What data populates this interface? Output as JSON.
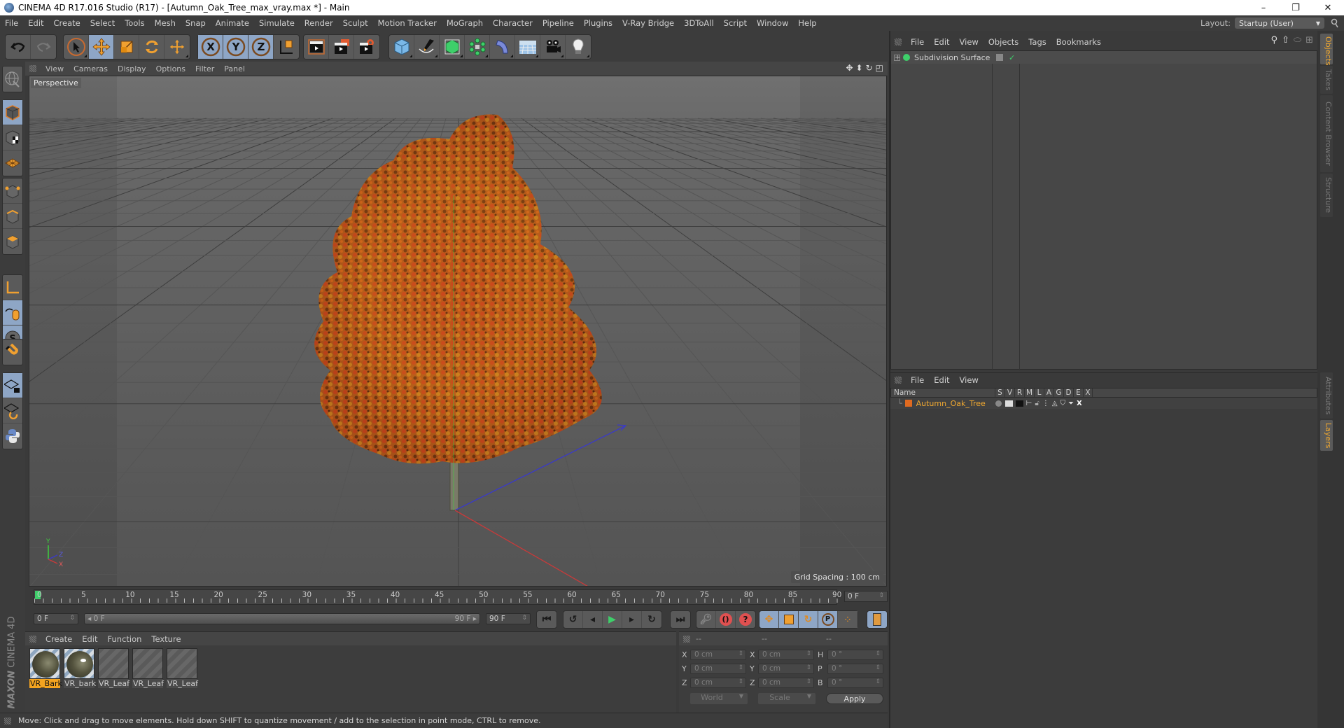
{
  "window": {
    "title": "CINEMA 4D R17.016 Studio (R17) - [Autumn_Oak_Tree_max_vray.max *] - Main",
    "controls": [
      "minimize",
      "restore",
      "close"
    ]
  },
  "menubar": {
    "items": [
      "File",
      "Edit",
      "Create",
      "Select",
      "Tools",
      "Mesh",
      "Snap",
      "Animate",
      "Simulate",
      "Render",
      "Sculpt",
      "Motion Tracker",
      "MoGraph",
      "Character",
      "Pipeline",
      "Plugins",
      "V-Ray Bridge",
      "3DToAll",
      "Script",
      "Window",
      "Help"
    ],
    "layout_label": "Layout:",
    "layout_value": "Startup (User)"
  },
  "toolbar": {
    "groups": [
      {
        "name": "history",
        "buttons": [
          {
            "icon": "undo-icon",
            "active": false
          },
          {
            "icon": "redo-icon",
            "active": false
          }
        ]
      },
      {
        "name": "tools",
        "buttons": [
          {
            "icon": "select-arrow-icon",
            "active": false
          },
          {
            "icon": "move-icon",
            "active": true
          },
          {
            "icon": "scale-icon",
            "active": false
          },
          {
            "icon": "rotate-icon",
            "active": false
          },
          {
            "icon": "move-extra-icon",
            "active": false
          }
        ]
      },
      {
        "name": "axes",
        "buttons": [
          {
            "icon": "x-axis-icon",
            "label": "X",
            "active": true
          },
          {
            "icon": "y-axis-icon",
            "label": "Y",
            "active": true
          },
          {
            "icon": "z-axis-icon",
            "label": "Z",
            "active": true
          },
          {
            "icon": "coordinate-system-icon",
            "active": false
          }
        ]
      },
      {
        "name": "render",
        "buttons": [
          {
            "icon": "render-view-icon"
          },
          {
            "icon": "render-picture-viewer-icon"
          },
          {
            "icon": "render-settings-icon"
          }
        ]
      },
      {
        "name": "objects",
        "buttons": [
          {
            "icon": "cube-icon"
          },
          {
            "icon": "pen-spline-icon"
          },
          {
            "icon": "subdivision-icon"
          },
          {
            "icon": "mograph-cloner-icon"
          },
          {
            "icon": "deformer-bend-icon"
          },
          {
            "icon": "floor-icon"
          },
          {
            "icon": "camera-icon"
          },
          {
            "icon": "light-icon"
          }
        ]
      }
    ]
  },
  "leftbar": {
    "tools": [
      "make-editable-icon",
      "model-mode-icon",
      "texture-mode-icon",
      "workplane-mode-icon",
      "points-mode-icon",
      "edges-mode-icon",
      "polygons-mode-icon",
      "axis-mode-icon",
      "tweak-mode-icon",
      "solo-mode-icon",
      "snap-magnet-icon",
      "workplane-lock-icon",
      "workplane-align-icon",
      "python-icon"
    ]
  },
  "viewport": {
    "menu": [
      "View",
      "Cameras",
      "Display",
      "Options",
      "Filter",
      "Panel"
    ],
    "camera_label": "Perspective",
    "grid_spacing": "Grid Spacing : 100 cm",
    "nav_icons": [
      "pan-icon",
      "dolly-icon",
      "orbit-icon",
      "maximize-view-icon"
    ],
    "axis_labels": {
      "y": "Y",
      "z": "Z",
      "x": "X"
    }
  },
  "timeline": {
    "ticks": [
      "0",
      "5",
      "10",
      "15",
      "20",
      "25",
      "30",
      "35",
      "40",
      "45",
      "50",
      "55",
      "60",
      "65",
      "70",
      "75",
      "80",
      "85",
      "90"
    ],
    "current_frame": "0 F",
    "start_field": "0 F",
    "range_start": "0 F",
    "range_end": "90 F",
    "end_field": "90 F"
  },
  "playback": {
    "buttons": [
      "go-to-start-icon",
      "previous-key-icon",
      "previous-frame-icon",
      "play-icon",
      "next-frame-icon",
      "next-key-icon",
      "go-to-end-icon"
    ],
    "record": [
      "motion-record-icon",
      "autokey-icon",
      "keyframe-selection-icon"
    ],
    "key_types": [
      "key-position-icon",
      "key-scale-icon",
      "key-rotation-icon",
      "key-parameter-icon",
      "key-pla-icon"
    ],
    "timeline_window": "timeline-icon"
  },
  "materials": {
    "menu": [
      "Create",
      "Edit",
      "Function",
      "Texture"
    ],
    "items": [
      {
        "name": "VR_Bark",
        "selected": true,
        "kind": "bark"
      },
      {
        "name": "VR_bark",
        "selected": false,
        "kind": "bark-gloss"
      },
      {
        "name": "VR_Leaf",
        "selected": false,
        "kind": "leaf"
      },
      {
        "name": "VR_Leaf",
        "selected": false,
        "kind": "leaf"
      },
      {
        "name": "VR_Leaf",
        "selected": false,
        "kind": "leaf"
      }
    ]
  },
  "coordinates": {
    "headers": [
      "--",
      "--",
      "--"
    ],
    "rows": [
      {
        "l1": "X",
        "v1": "0 cm",
        "l2": "X",
        "v2": "0 cm",
        "l3": "H",
        "v3": "0 °"
      },
      {
        "l1": "Y",
        "v1": "0 cm",
        "l2": "Y",
        "v2": "0 cm",
        "l3": "P",
        "v3": "0 °"
      },
      {
        "l1": "Z",
        "v1": "0 cm",
        "l2": "Z",
        "v2": "0 cm",
        "l3": "B",
        "v3": "0 °"
      }
    ],
    "space": "World",
    "mode": "Scale",
    "apply": "Apply"
  },
  "status": {
    "text": "Move: Click and drag to move elements. Hold down SHIFT to quantize movement / add to the selection in point mode, CTRL to remove."
  },
  "brand": {
    "maxon": "MAXON",
    "product": "CINEMA 4D"
  },
  "objects_panel": {
    "menu": [
      "File",
      "Edit",
      "View",
      "Objects",
      "Tags",
      "Bookmarks"
    ],
    "tool_icons": [
      "search-icon",
      "home-icon",
      "view-icon",
      "new-panel-icon"
    ],
    "items": [
      {
        "name": "Subdivision Surface",
        "color": "#3ecf6a"
      }
    ]
  },
  "layers_panel": {
    "menu": [
      "File",
      "Edit",
      "View"
    ],
    "columns": [
      "Name",
      "S",
      "V",
      "R",
      "M",
      "L",
      "A",
      "G",
      "D",
      "E",
      "X"
    ],
    "items": [
      {
        "name": "Autumn_Oak_Tree",
        "color": "#e06a20"
      }
    ]
  },
  "side_tabs": {
    "top": [
      {
        "label": "Objects",
        "active": true
      },
      {
        "label": "Takes",
        "active": false
      },
      {
        "label": "Content Browser",
        "active": false
      },
      {
        "label": "Structure",
        "active": false
      }
    ],
    "bottom": [
      {
        "label": "Attributes",
        "active": false
      },
      {
        "label": "Layers",
        "active": true
      }
    ]
  },
  "colors": {
    "accent_orange": "#f4a420",
    "active_blue": "#8ea6c6",
    "panel_bg": "#3a3a3a",
    "viewport_bg": "#585858"
  }
}
